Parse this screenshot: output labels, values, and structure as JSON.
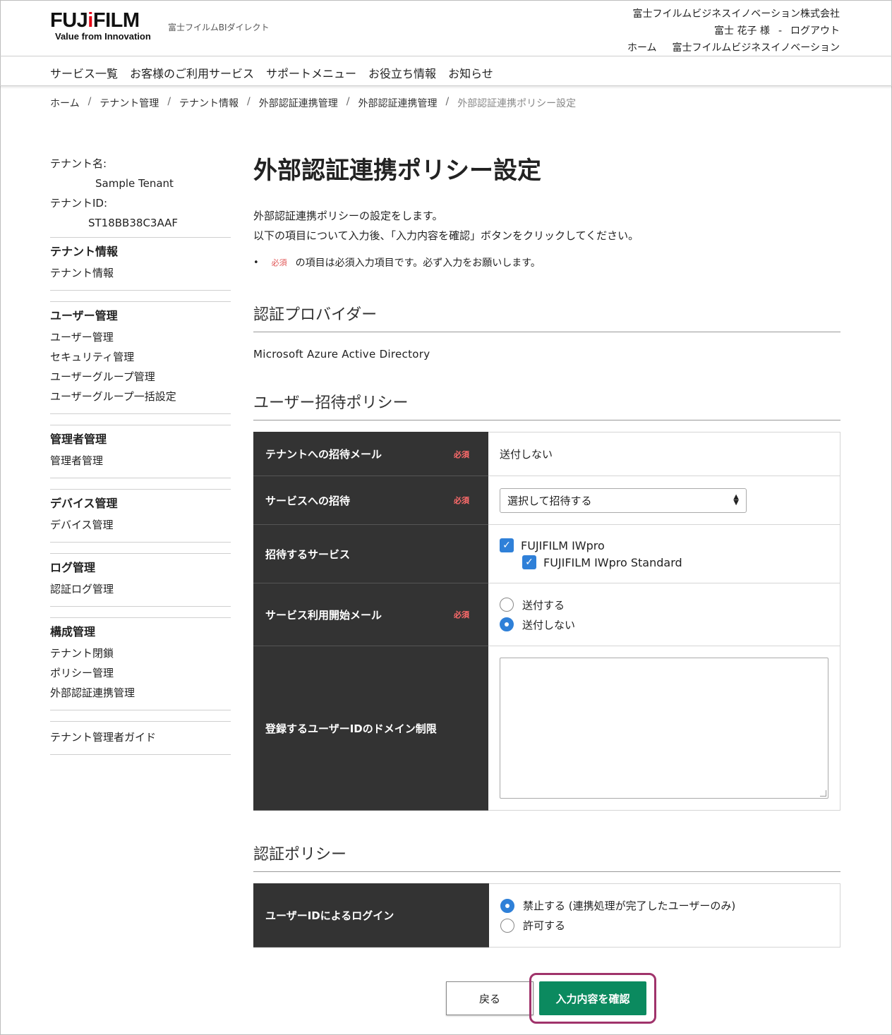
{
  "header": {
    "logo_text_a": "FUJ",
    "logo_text_red": "i",
    "logo_text_b": "FILM",
    "logo_tagline": "Value from Innovation",
    "site_name": "富士フイルムBIダイレクト",
    "company": "富士フイルムビジネスイノベーション株式会社",
    "user_name": "富士 花子 様",
    "separator": "-",
    "logout": "ログアウト",
    "home_link": "ホーム",
    "corp_link": "富士フイルムビジネスイノベーション"
  },
  "nav": {
    "items": [
      "サービス一覧",
      "お客様のご利用サービス",
      "サポートメニュー",
      "お役立ち情報",
      "お知らせ"
    ]
  },
  "breadcrumb": {
    "items": [
      "ホーム",
      "テナント管理",
      "テナント情報",
      "外部認証連携管理",
      "外部認証連携管理"
    ],
    "separator": "/",
    "current": "外部認証連携ポリシー設定"
  },
  "sidebar": {
    "tenant_name_label": "テナント名:",
    "tenant_name": "Sample Tenant",
    "tenant_id_label": "テナントID:",
    "tenant_id": "ST18BB38C3AAF",
    "groups": [
      {
        "title": "テナント情報",
        "items": [
          "テナント情報"
        ]
      },
      {
        "title": "ユーザー管理",
        "items": [
          "ユーザー管理",
          "セキュリティ管理",
          "ユーザーグループ管理",
          "ユーザーグループ一括設定"
        ]
      },
      {
        "title": "管理者管理",
        "items": [
          "管理者管理"
        ]
      },
      {
        "title": "デバイス管理",
        "items": [
          "デバイス管理"
        ]
      },
      {
        "title": "ログ管理",
        "items": [
          "認証ログ管理"
        ]
      },
      {
        "title": "構成管理",
        "items": [
          "テナント閉鎖",
          "ポリシー管理",
          "外部認証連携管理"
        ]
      }
    ],
    "guide": "テナント管理者ガイド"
  },
  "main": {
    "title": "外部認証連携ポリシー設定",
    "intro_line1": "外部認証連携ポリシーの設定をします。",
    "intro_line2": "以下の項目について入力後、「入力内容を確認」ボタンをクリックしてください。",
    "note_bullet": "•",
    "required_label": "必須",
    "note_text": "の項目は必須入力項目です。必ず入力をお願いします。",
    "provider_section": "認証プロバイダー",
    "provider_value": "Microsoft Azure Active Directory",
    "invite_section": "ユーザー招待ポリシー",
    "invite_rows": {
      "tenant_mail_label": "テナントへの招待メール",
      "tenant_mail_value": "送付しない",
      "service_invite_label": "サービスへの招待",
      "service_invite_selected": "選択して招待する",
      "services_label": "招待するサービス",
      "service_1": "FUJIFILM IWpro",
      "service_2": "FUJIFILM IWpro Standard",
      "start_mail_label": "サービス利用開始メール",
      "start_mail_opt1": "送付する",
      "start_mail_opt2": "送付しない",
      "domain_label": "登録するユーザーIDのドメイン制限",
      "domain_value": ""
    },
    "auth_section": "認証ポリシー",
    "auth_rows": {
      "login_label": "ユーザーIDによるログイン",
      "login_opt1": "禁止する (連携処理が完了したユーザーのみ)",
      "login_opt2": "許可する"
    }
  },
  "buttons": {
    "back": "戻る",
    "confirm": "入力内容を確認"
  },
  "colors": {
    "table_header_bg": "#333333",
    "required_text": "#e05555",
    "accent_blue": "#2f80d8",
    "confirm_green": "#0b8a5f",
    "highlight_border": "#a0336b",
    "logo_red": "#e60012"
  }
}
